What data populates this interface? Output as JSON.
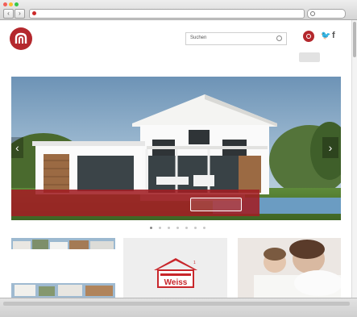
{
  "browser": {
    "tab_title": "",
    "url": "",
    "search_placeholder": "",
    "back_label": "‹",
    "forward_label": "›"
  },
  "header": {
    "links": [
      "",
      "",
      "",
      ""
    ],
    "search_value": "Suchen",
    "account_label": "",
    "twitter_glyph": "🐦",
    "facebook_glyph": "f"
  },
  "nav": {
    "items": [
      "",
      "",
      "",
      "",
      "",
      "",
      "",
      "",
      ""
    ]
  },
  "hero": {
    "headline": "",
    "subline": "",
    "button_label": "",
    "slide_count": 7,
    "active_slide": 1
  },
  "cards": {
    "left_text": "",
    "middle_title": "",
    "middle_logo_text": "Weiss",
    "middle_logo_number": "1",
    "right_text": ""
  },
  "colors": {
    "brand": "#b4282d",
    "caption_bg": "#a01e23"
  }
}
